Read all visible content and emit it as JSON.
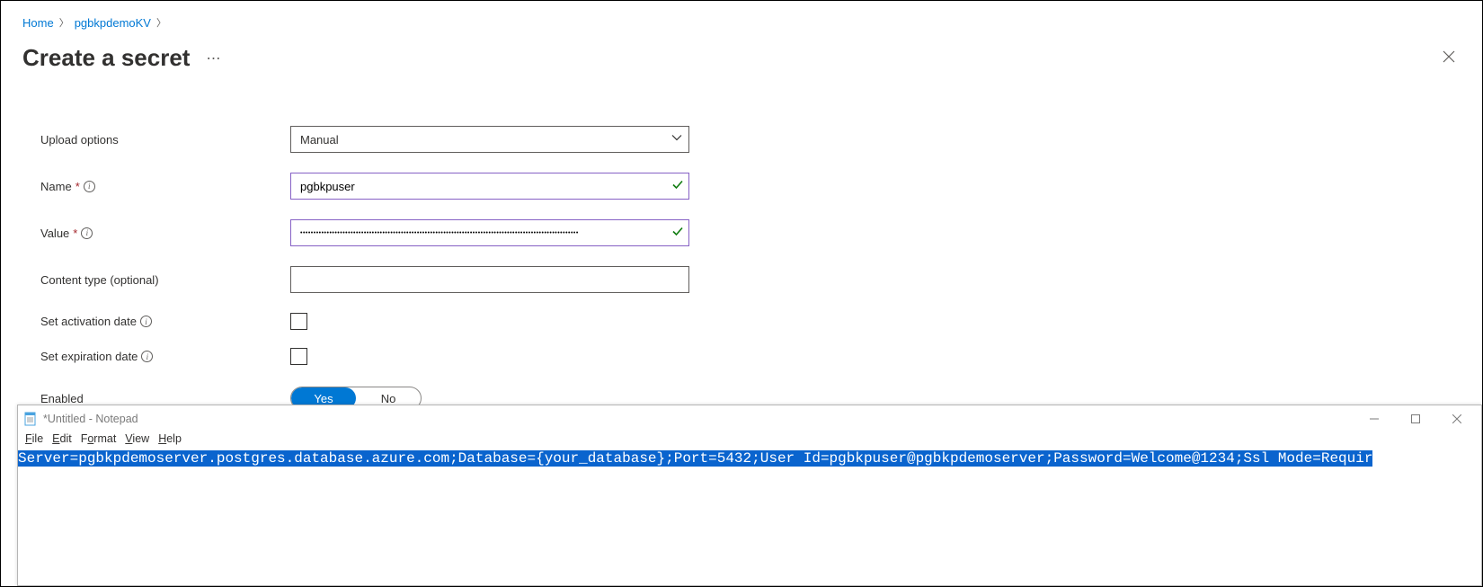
{
  "breadcrumb": {
    "home": "Home",
    "kv": "pgbkpdemoKV"
  },
  "header": {
    "title": "Create a secret",
    "more": "⋯"
  },
  "form": {
    "upload_label": "Upload options",
    "upload_value": "Manual",
    "name_label": "Name",
    "name_value": "pgbkpuser",
    "value_label": "Value",
    "value_value": "•••••••••••••••••••••••••••••••••••••••••••••••••••••••••••••••••••••••••••••••••••••••••••••••••••••••••",
    "content_label": "Content type (optional)",
    "content_value": "",
    "activation_label": "Set activation date",
    "expiration_label": "Set expiration date",
    "enabled_label": "Enabled",
    "enabled_yes": "Yes",
    "enabled_no": "No"
  },
  "notepad": {
    "title": "*Untitled - Notepad",
    "menu": {
      "file": "File",
      "edit": "Edit",
      "format": "Format",
      "view": "View",
      "help": "Help"
    },
    "content": "Server=pgbkpdemoserver.postgres.database.azure.com;Database={your_database};Port=5432;User Id=pgbkpuser@pgbkpdemoserver;Password=Welcome@1234;Ssl Mode=Requir"
  }
}
